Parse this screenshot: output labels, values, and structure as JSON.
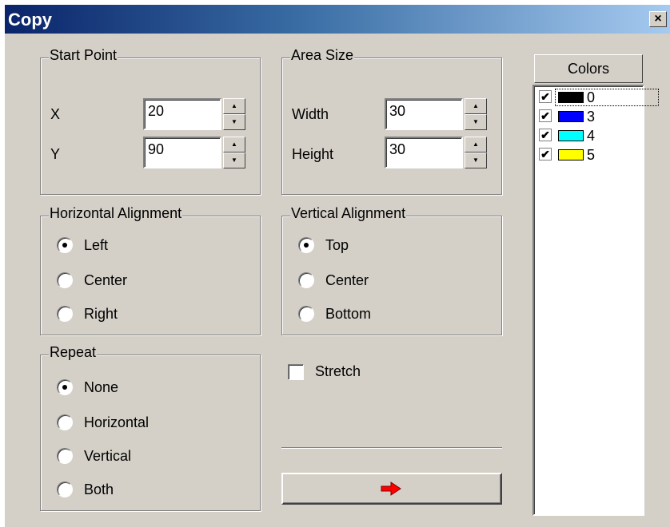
{
  "window": {
    "title": "Copy",
    "close_glyph": "×"
  },
  "start_point": {
    "legend": "Start Point",
    "x_label": "X",
    "x_value": "20",
    "y_label": "Y",
    "y_value": "90"
  },
  "area_size": {
    "legend": "Area Size",
    "width_label": "Width",
    "width_value": "30",
    "height_label": "Height",
    "height_value": "30"
  },
  "horizontal_alignment": {
    "legend": "Horizontal Alignment",
    "options": [
      "Left",
      "Center",
      "Right"
    ],
    "selected": "Left"
  },
  "vertical_alignment": {
    "legend": "Vertical Alignment",
    "options": [
      "Top",
      "Center",
      "Bottom"
    ],
    "selected": "Top"
  },
  "repeat": {
    "legend": "Repeat",
    "options": [
      "None",
      "Horizontal",
      "Vertical",
      "Both"
    ],
    "selected": "None"
  },
  "stretch": {
    "label": "Stretch",
    "checked": false
  },
  "apply_button": {
    "icon": "right-arrow-icon",
    "color": "#ff0000"
  },
  "colors": {
    "header": "Colors",
    "items": [
      {
        "label": "0",
        "checked": true,
        "color": "#000000"
      },
      {
        "label": "3",
        "checked": true,
        "color": "#0000ff"
      },
      {
        "label": "4",
        "checked": true,
        "color": "#00ffff"
      },
      {
        "label": "5",
        "checked": true,
        "color": "#ffff00"
      }
    ]
  }
}
